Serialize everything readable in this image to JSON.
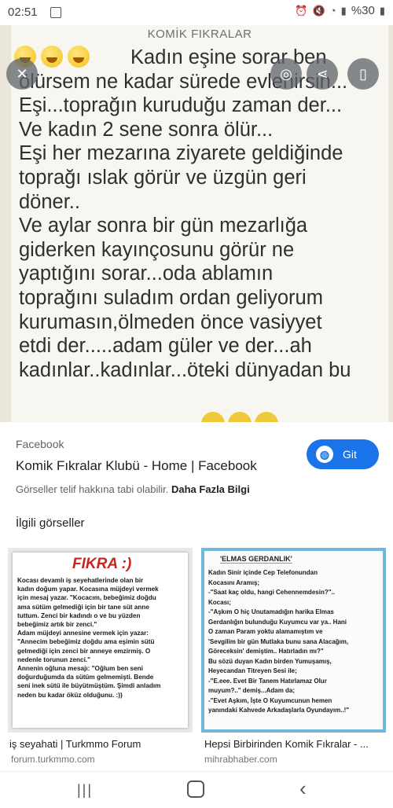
{
  "status_bar": {
    "time": "02:51",
    "battery": "%30"
  },
  "viewer": {
    "header": "KOMİK FIKRALAR",
    "joke_text": "Kadın eşine sorar ben\nölürsem ne kadar sürede evlenirsin...\nEşi...toprağın kuruduğu zaman der...\nVe kadın 2 sene sonra ölür...\nEşi her mezarına ziyarete geldiğinde\ntoprağı ıslak görür ve üzgün geri\ndöner..\nVe aylar sonra bir gün mezarlığa\ngiderken kayınçosunu  görür ne\nyaptığını sorar...oda ablamın\ntoprağını suladım ordan geliyorum\nkurumasın,ölmeden önce vasiyyet\netdi der.....adam güler ve der...ah\nkadınlar..kadınlar...öteki dünyadan bu"
  },
  "info": {
    "source": "Facebook",
    "title": "Komik Fıkralar Klubü - Home | Facebook",
    "copyright": "Görseller telif hakkına tabi olabilir.",
    "more_info": "Daha Fazla Bilgi",
    "visit_label": "Git",
    "related_heading": "İlgili görseller"
  },
  "related": [
    {
      "image_title": "FIKRA :)",
      "image_text": "Kocası devamlı iş seyehatlerinde olan bir\nkadın doğum yapar. Kocasına müjdeyi vermek\niçin mesaj yazar. \"Kocacım, bebeğimiz doğdu\nama sütüm gelmediği için bir tane süt anne\ntuttum. Zenci bir kadındı o ve bu yüzden\nbebeğimiz artık bir zenci.\"\nAdam müjdeyi annesine vermek için yazar:\n\"Annecim bebeğimiz doğdu ama eşimin sütü\ngelmediği için zenci bir anneye emzirmiş. O\nnedenle torunun zenci.\"\nAnnenin oğluna mesajı: \"Oğlum ben seni\ndoğurduğumda da sütüm gelmemişti. Bende\nseni inek sütü ile büyütmüştüm. Şimdi anladım\nneden bu kadar öküz olduğunu. :))",
      "caption": "iş seyahati | Turkmmo Forum",
      "source": "forum.turkmmo.com"
    },
    {
      "image_title": "'ELMAS GERDANLIK'",
      "image_text": "Kadın Sinir içinde Cep Telefonundan\nKocasını Aramış;\n-\"Saat kaç oldu, hangi Cehennemdesin?\"..\nKocası;\n-\"Aşkım O hiç Unutamadığın harika Elmas\nGerdanlığın bulunduğu Kuyumcu var ya.. Hani\nO zaman Param yoktu alamamıştım ve\n'Sevgilim bir gün Mutlaka bunu sana Alacağım,\nGöreceksin' demiştim.. Hatırladın mı?\"\nBu sözü duyan Kadın birden Yumuşamış,\nHeyecandan Titreyen Sesi ile;\n-\"E.eee. Evet Bir Tanem Hatırlamaz Olur\nmuyum?..\" demiş...Adam da;\n-\"Evet Aşkım, İşte O Kuyumcunun hemen\nyanındaki Kahvede Arkadaşlarla Oyundayım..!\"",
      "caption": "Hepsi Birbirinden Komik Fıkralar - ...",
      "source": "mihrabhaber.com"
    }
  ],
  "icons": {
    "close": "close-icon",
    "lens": "lens-icon",
    "share": "share-icon",
    "save": "bookmark-icon"
  },
  "colors": {
    "accent": "#1a73e8"
  }
}
